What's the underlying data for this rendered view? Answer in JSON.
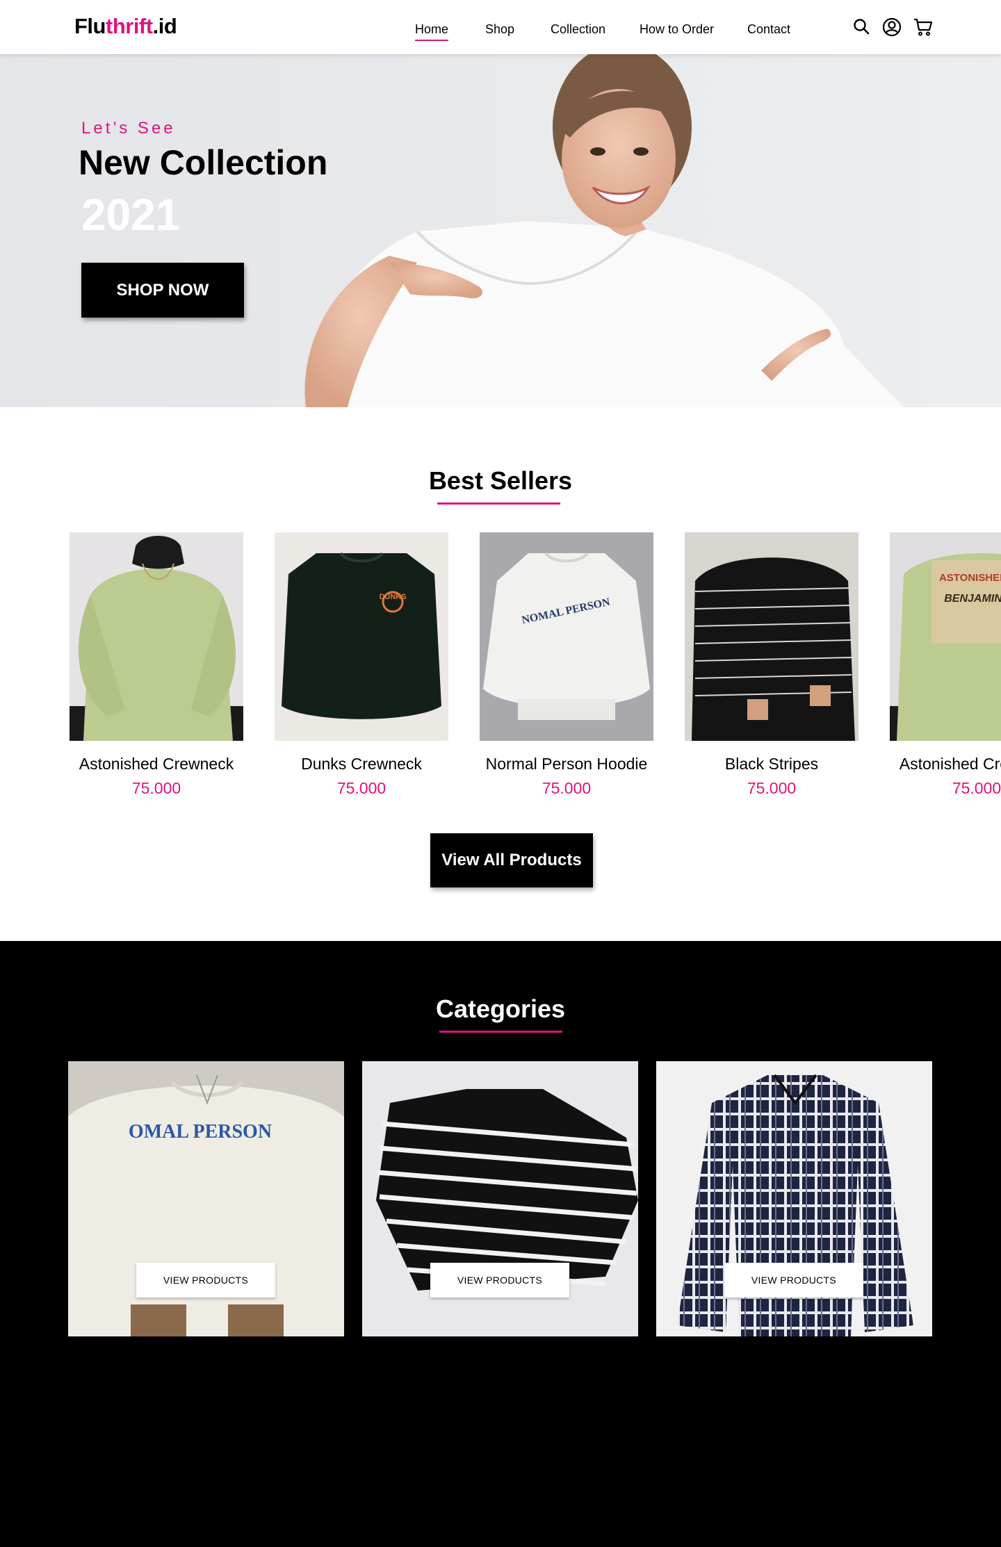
{
  "header": {
    "logo_main": "Flu",
    "logo_accent": "thrift",
    "logo_suffix": ".id",
    "nav": [
      "Home",
      "Shop",
      "Collection",
      "How to Order",
      "Contact"
    ],
    "active_nav": "Home",
    "icons": [
      "search-icon",
      "user-icon",
      "cart-icon"
    ]
  },
  "hero": {
    "eyebrow": "Let’s See",
    "title": "New Collection",
    "year": "2021",
    "cta": "SHOP NOW"
  },
  "best_sellers": {
    "title": "Best Sellers",
    "products": [
      {
        "name": "Astonished Crewneck",
        "price": "75.000"
      },
      {
        "name": "Dunks Crewneck",
        "price": "75.000"
      },
      {
        "name": "Normal Person Hoodie",
        "price": "75.000"
      },
      {
        "name": "Black Stripes",
        "price": "75.000"
      },
      {
        "name": "Astonished Crewneck",
        "price": "75.000"
      }
    ],
    "view_all": "View All Products"
  },
  "categories": {
    "title": "Categories",
    "cards": [
      {
        "button": "VIEW PRODUCTS"
      },
      {
        "button": "VIEW PRODUCTS"
      },
      {
        "button": "VIEW PRODUCTS"
      }
    ]
  },
  "colors": {
    "accent": "#e0127f",
    "dark": "#000000",
    "hero_bg": "#e6e7e9"
  }
}
